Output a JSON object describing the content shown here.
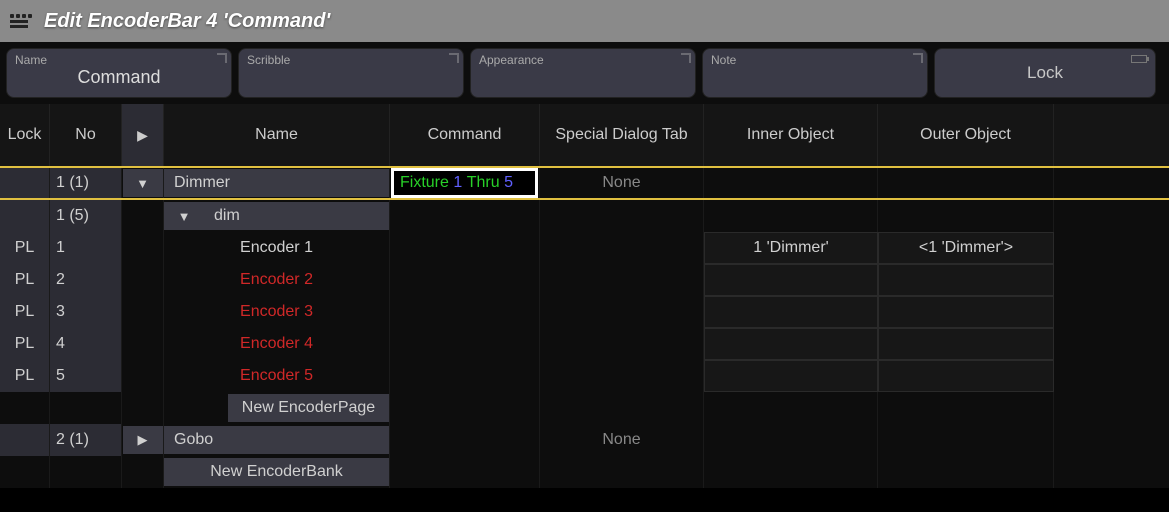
{
  "titlebar": {
    "title": "Edit EncoderBar 4 'Command'"
  },
  "toolbar": {
    "name": {
      "label": "Name",
      "value": "Command"
    },
    "scribble": {
      "label": "Scribble",
      "value": ""
    },
    "appearance": {
      "label": "Appearance",
      "value": ""
    },
    "note": {
      "label": "Note",
      "value": ""
    },
    "lock": {
      "label": "Lock"
    }
  },
  "headers": {
    "lock": "Lock",
    "no": "No",
    "play": "▶",
    "name": "Name",
    "command": "Command",
    "special": "Special Dialog Tab",
    "inner": "Inner Object",
    "outer": "Outer Object"
  },
  "rows": {
    "r1": {
      "no": "1 (1)",
      "arrow": "▼",
      "name": "Dimmer",
      "cmd_kw1": "Fixture",
      "cmd_n1": "1",
      "cmd_kw2": "Thru",
      "cmd_n2": "5",
      "special": "None"
    },
    "r2": {
      "no": "1 (5)",
      "arrow": "▼",
      "name": "dim"
    },
    "enc1": {
      "lock": "PL",
      "no": "1",
      "name": "Encoder 1",
      "inner": "1 'Dimmer'",
      "outer": "<1 'Dimmer'>"
    },
    "enc2": {
      "lock": "PL",
      "no": "2",
      "name": "Encoder 2"
    },
    "enc3": {
      "lock": "PL",
      "no": "3",
      "name": "Encoder 3"
    },
    "enc4": {
      "lock": "PL",
      "no": "4",
      "name": "Encoder 4"
    },
    "enc5": {
      "lock": "PL",
      "no": "5",
      "name": "Encoder 5"
    },
    "newEncPage": {
      "label": "New EncoderPage"
    },
    "r3": {
      "no": "2 (1)",
      "arrow": "▶",
      "name": "Gobo",
      "special": "None"
    },
    "newEncBank": {
      "label": "New EncoderBank"
    }
  }
}
